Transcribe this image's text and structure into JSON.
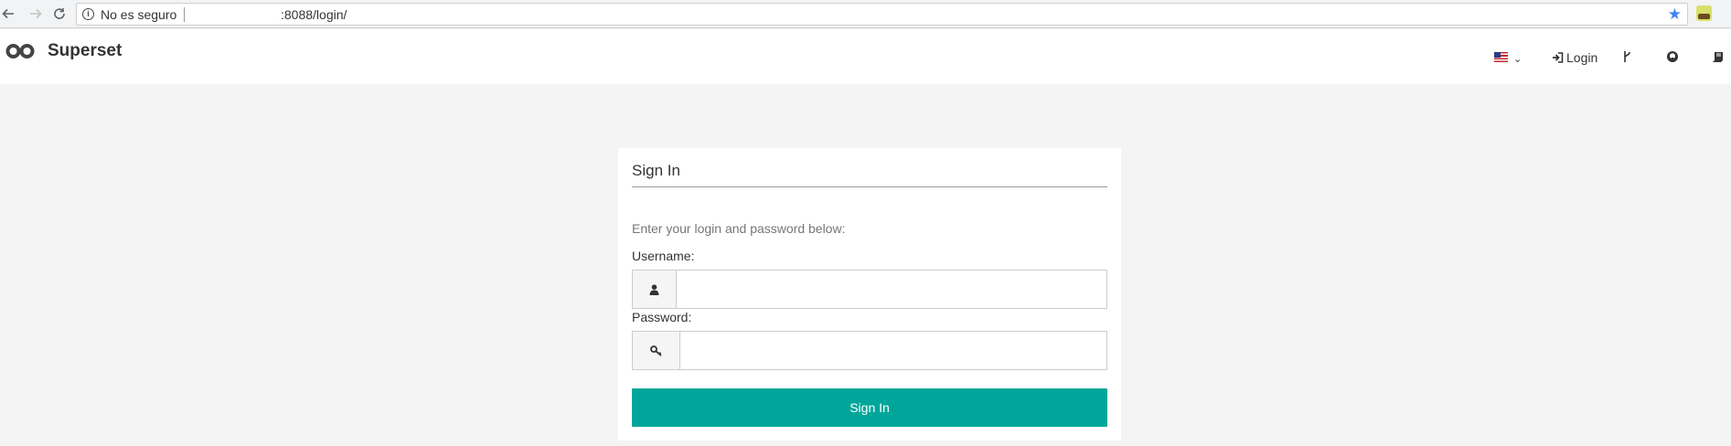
{
  "browser": {
    "security_label": "No es seguro",
    "url": ":8088/login/"
  },
  "navbar": {
    "brand": "Superset",
    "login_label": "Login",
    "language_flag": "us-flag-icon"
  },
  "login_panel": {
    "title": "Sign In",
    "intro": "Enter your login and password below:",
    "username_label": "Username:",
    "username_value": "",
    "password_label": "Password:",
    "password_value": "",
    "submit_label": "Sign In"
  },
  "colors": {
    "accent": "#00a699",
    "page_background": "#f4f4f4",
    "star": "#4285f4"
  }
}
